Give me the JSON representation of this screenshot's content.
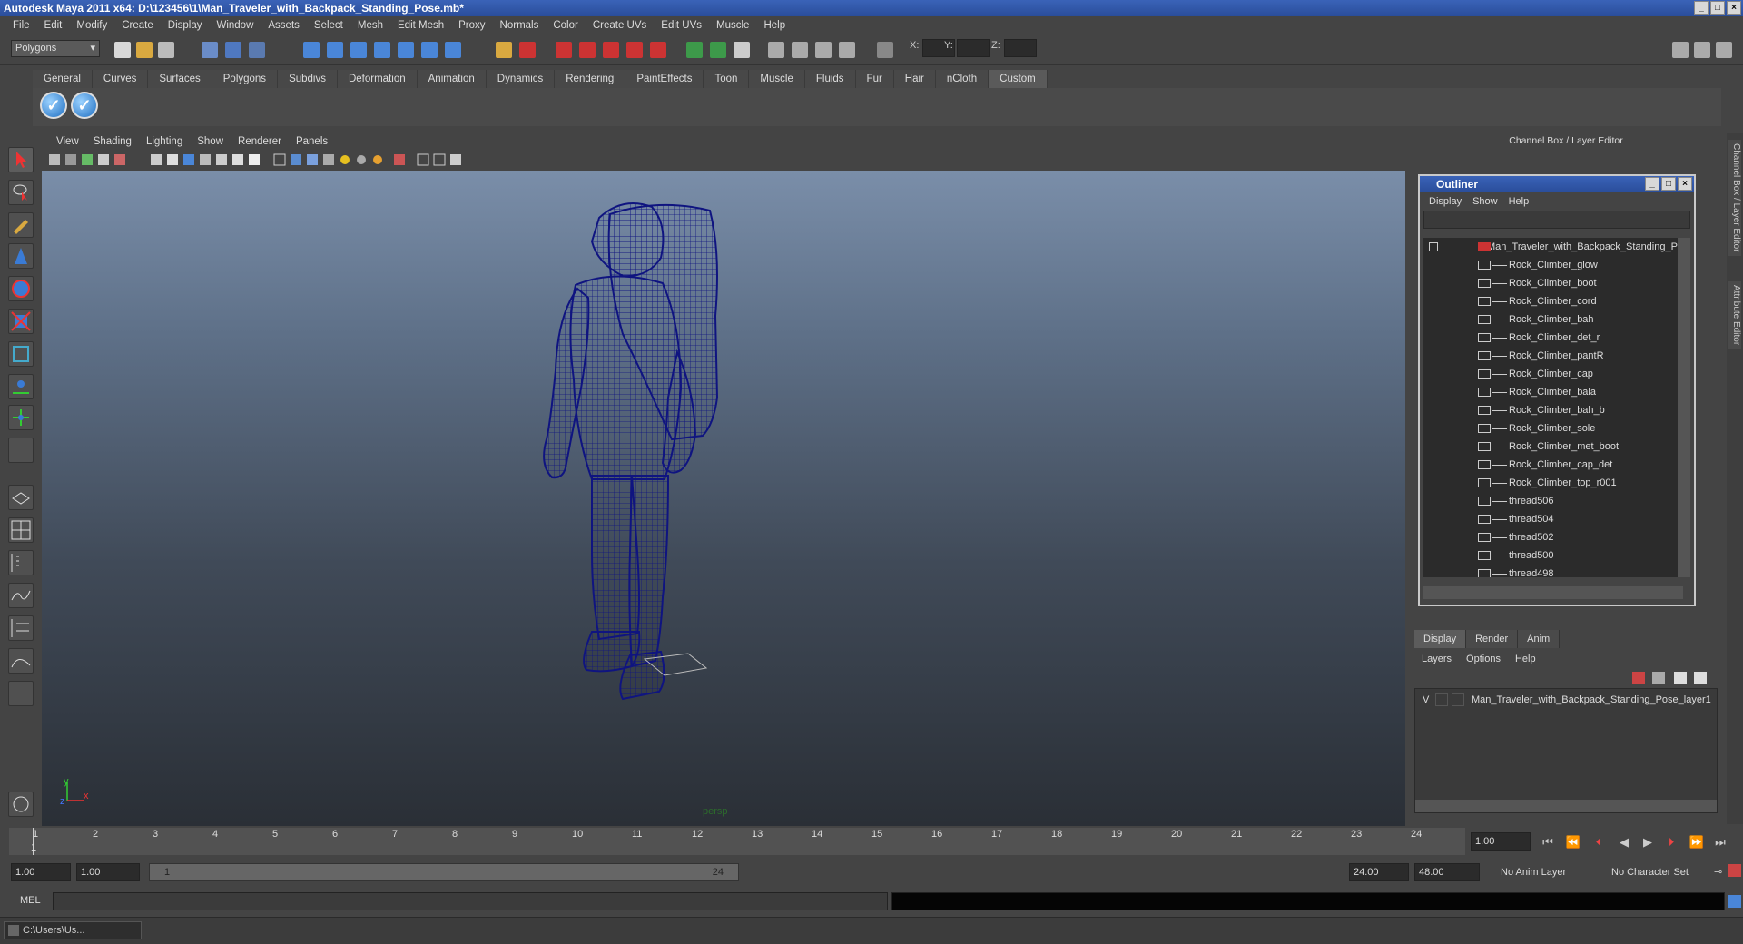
{
  "window": {
    "title": "Autodesk Maya 2011 x64: D:\\123456\\1\\Man_Traveler_with_Backpack_Standing_Pose.mb*"
  },
  "menubar": [
    "File",
    "Edit",
    "Modify",
    "Create",
    "Display",
    "Window",
    "Assets",
    "Select",
    "Mesh",
    "Edit Mesh",
    "Proxy",
    "Normals",
    "Color",
    "Create UVs",
    "Edit UVs",
    "Muscle",
    "Help"
  ],
  "status_line": {
    "mode": "Polygons",
    "x_label": "X:",
    "y_label": "Y:",
    "z_label": "Z:"
  },
  "shelf": {
    "tabs": [
      "General",
      "Curves",
      "Surfaces",
      "Polygons",
      "Subdivs",
      "Deformation",
      "Animation",
      "Dynamics",
      "Rendering",
      "PaintEffects",
      "Toon",
      "Muscle",
      "Fluids",
      "Fur",
      "Hair",
      "nCloth",
      "Custom"
    ],
    "active_tab": "Custom",
    "buttons": [
      "checkmark-icon",
      "checkmark-icon"
    ]
  },
  "viewport": {
    "menu": [
      "View",
      "Shading",
      "Lighting",
      "Show",
      "Renderer",
      "Panels"
    ],
    "camera_label": "persp",
    "axis": {
      "x": "x",
      "y": "y",
      "z": "z"
    },
    "wireframe_color": "#0f1480"
  },
  "timeline": {
    "ticks": [
      "1",
      "2",
      "3",
      "4",
      "5",
      "6",
      "7",
      "8",
      "9",
      "10",
      "11",
      "12",
      "13",
      "14",
      "15",
      "16",
      "17",
      "18",
      "19",
      "20",
      "21",
      "22",
      "23",
      "24"
    ],
    "current_marker": "1",
    "current_time": "1.00"
  },
  "range": {
    "start": "1.00",
    "playback_start": "1.00",
    "slider_start": "1",
    "slider_end": "24",
    "playback_end": "24.00",
    "end": "48.00",
    "anim_layer": "No Anim Layer",
    "character_set": "No Character Set"
  },
  "command_line": {
    "label": "MEL"
  },
  "taskbar": {
    "item": "C:\\Users\\Us..."
  },
  "channel_box": {
    "header": "Channel Box / Layer Editor"
  },
  "outliner": {
    "title": "Outliner",
    "menu": [
      "Display",
      "Show",
      "Help"
    ],
    "root": "Man_Traveler_with_Backpack_Standing_Pos",
    "items": [
      "Rock_Climber_glow",
      "Rock_Climber_boot",
      "Rock_Climber_cord",
      "Rock_Climber_bah",
      "Rock_Climber_det_r",
      "Rock_Climber_pantR",
      "Rock_Climber_cap",
      "Rock_Climber_bala",
      "Rock_Climber_bah_b",
      "Rock_Climber_sole",
      "Rock_Climber_met_boot",
      "Rock_Climber_cap_det",
      "Rock_Climber_top_r001",
      "thread506",
      "thread504",
      "thread502",
      "thread500",
      "thread498"
    ]
  },
  "layer_editor": {
    "tabs": [
      "Display",
      "Render",
      "Anim"
    ],
    "active_tab": "Display",
    "menu": [
      "Layers",
      "Options",
      "Help"
    ],
    "layer": {
      "visibility": "V",
      "name": "Man_Traveler_with_Backpack_Standing_Pose_layer1"
    }
  },
  "side_tabs": [
    "Channel Box / Layer Editor",
    "Attribute Editor"
  ]
}
